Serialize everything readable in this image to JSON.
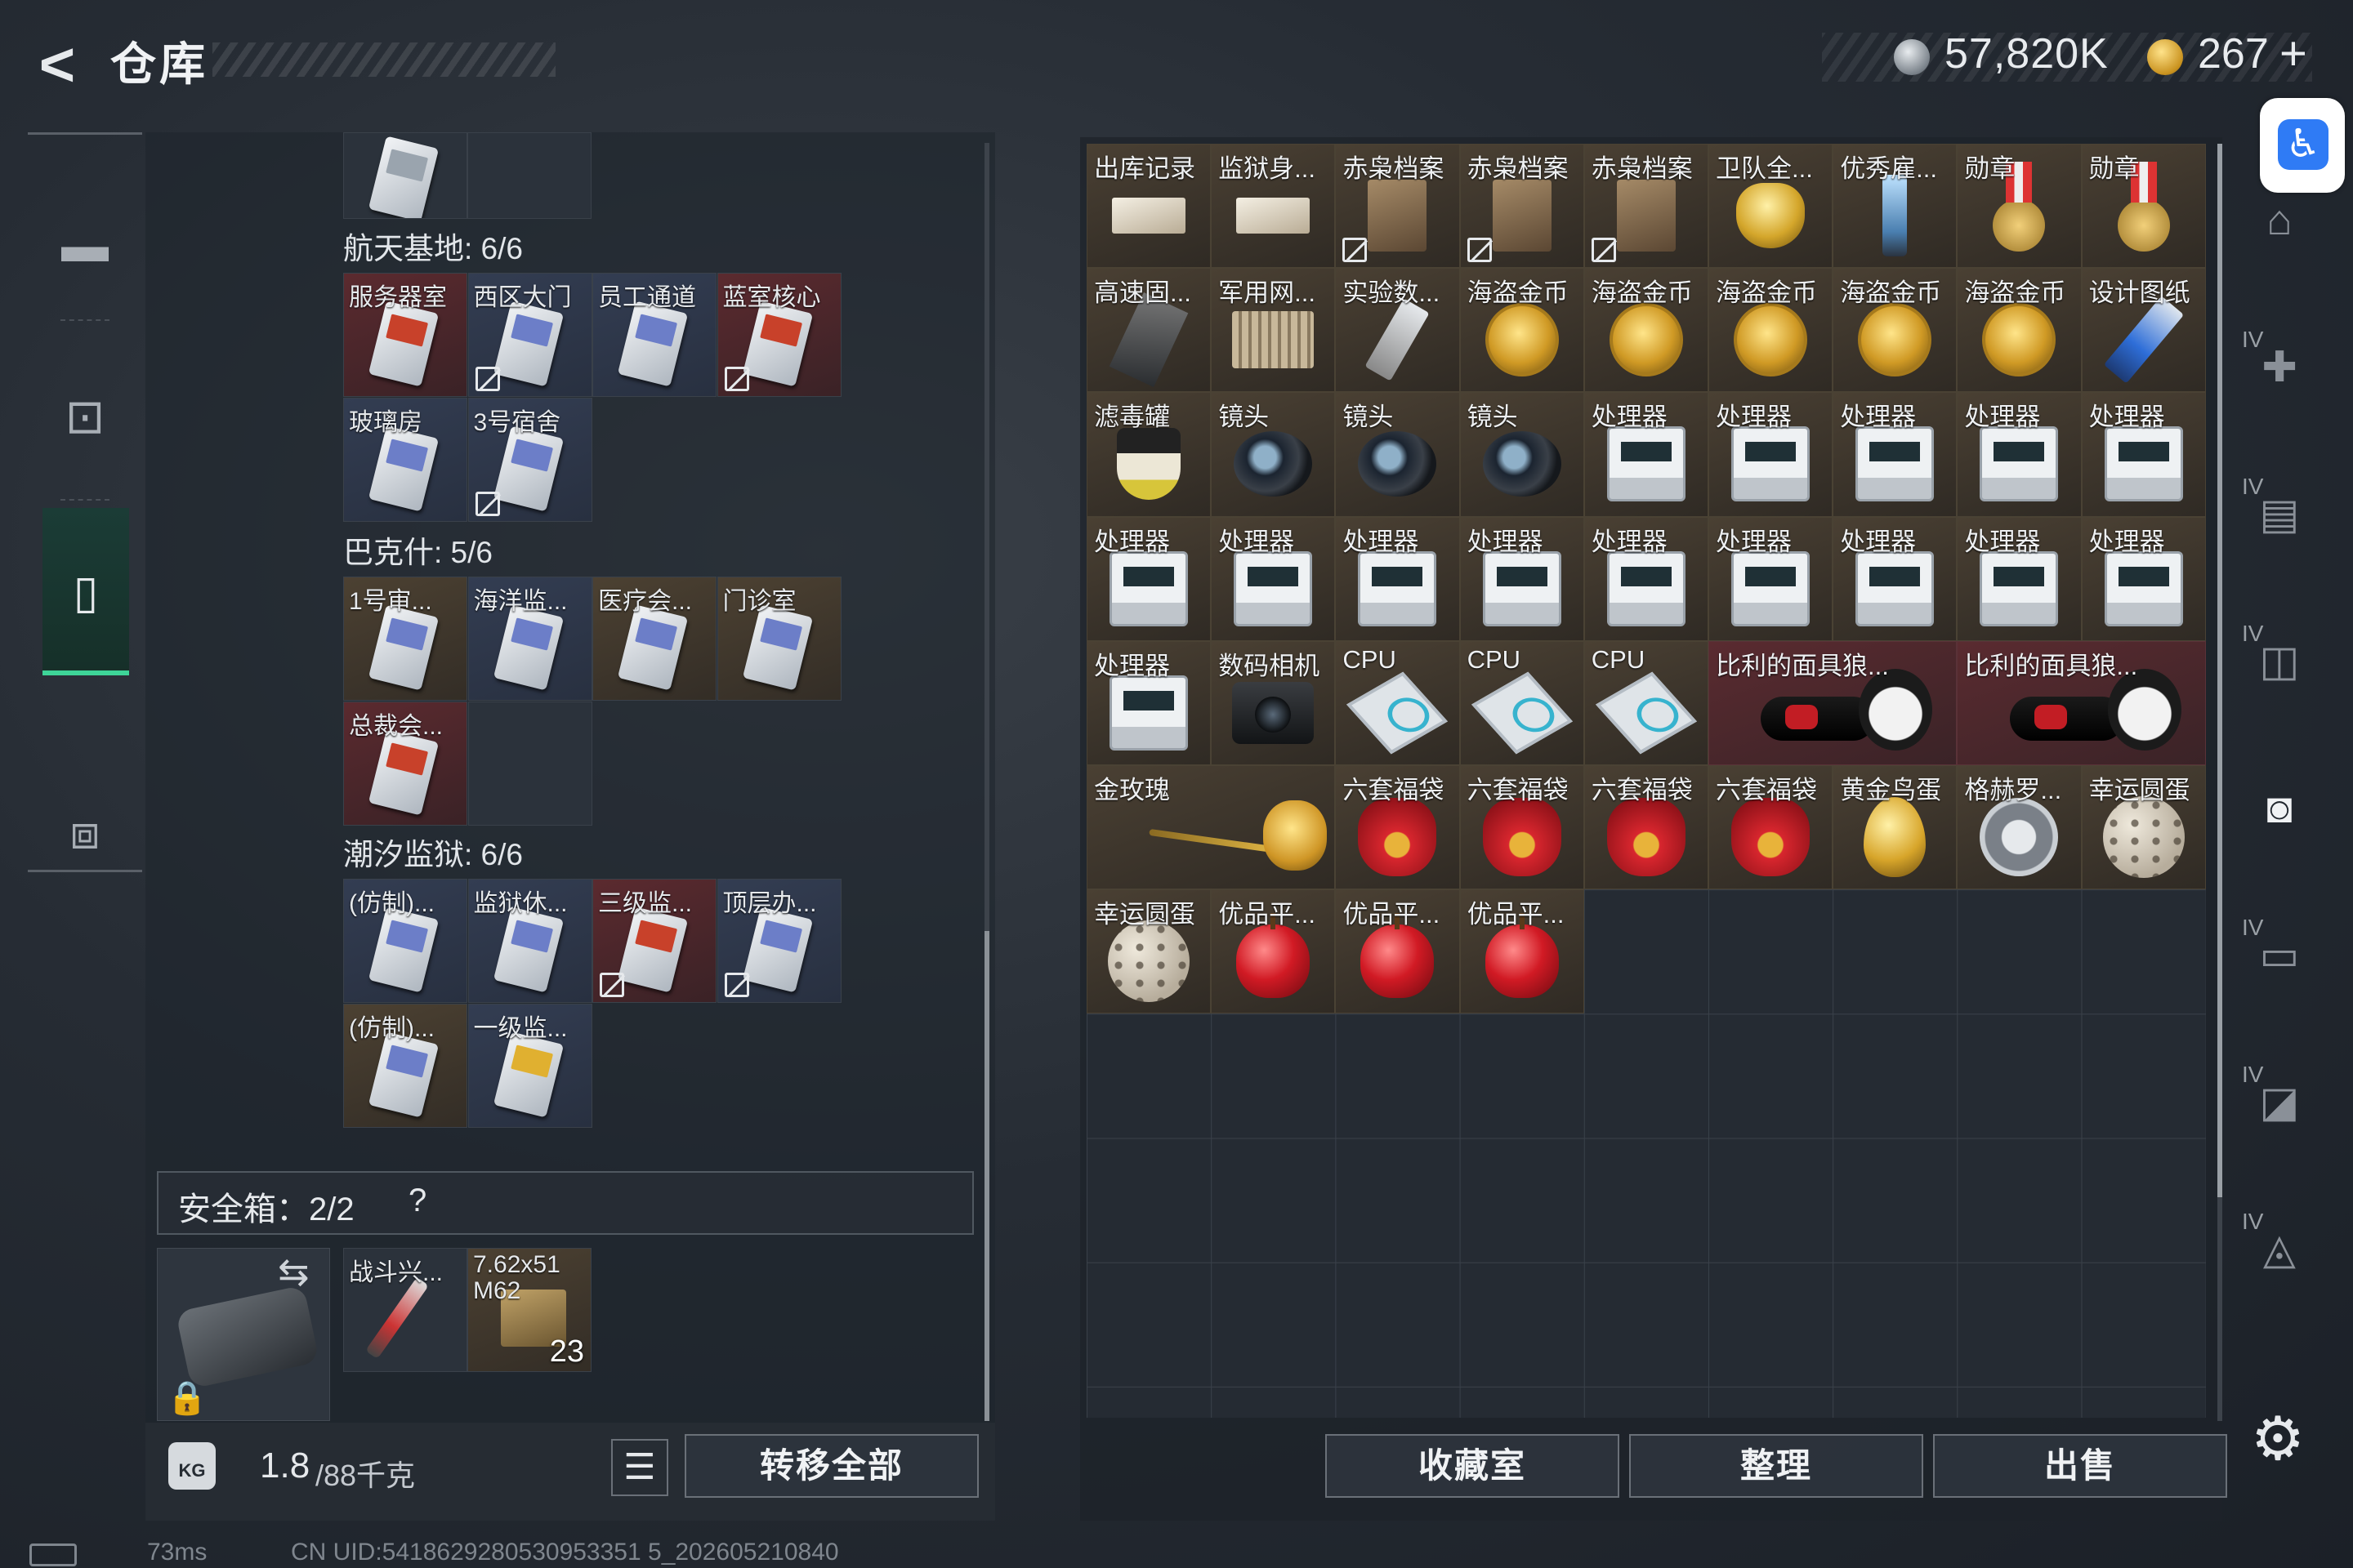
{
  "header": {
    "back_label": "<",
    "title": "仓库",
    "money": "57,820K",
    "coins": "267",
    "coins_plus": "+"
  },
  "left_nav": {
    "icons": [
      "gun-icon",
      "backpack-icon",
      "case-icon",
      "toolbox-icon"
    ],
    "active": "case-icon"
  },
  "stash": {
    "sections": [
      {
        "label": "航天基地: 6/6",
        "items": [
          {
            "label": "服务器室",
            "bg": "red",
            "no_insure": false
          },
          {
            "label": "西区大门",
            "bg": "blue",
            "no_insure": true
          },
          {
            "label": "员工通道",
            "bg": "blue",
            "no_insure": false
          },
          {
            "label": "蓝室核心",
            "bg": "red",
            "no_insure": true
          },
          {
            "label": "玻璃房",
            "bg": "blue",
            "no_insure": false
          },
          {
            "label": "3号宿舍",
            "bg": "blue",
            "no_insure": true
          }
        ]
      },
      {
        "label": "巴克什: 5/6",
        "items": [
          {
            "label": "1号审...",
            "bg": "gold",
            "no_insure": false
          },
          {
            "label": "海洋监...",
            "bg": "blue",
            "no_insure": false
          },
          {
            "label": "医疗会...",
            "bg": "gold",
            "no_insure": false
          },
          {
            "label": "门诊室",
            "bg": "gold",
            "no_insure": false
          },
          {
            "label": "总裁会...",
            "bg": "red",
            "no_insure": false
          }
        ]
      },
      {
        "label": "潮汐监狱: 6/6",
        "items": [
          {
            "label": "(仿制)...",
            "bg": "blue",
            "no_insure": false
          },
          {
            "label": "监狱休...",
            "bg": "blue",
            "no_insure": false
          },
          {
            "label": "三级监...",
            "bg": "red",
            "no_insure": true
          },
          {
            "label": "顶层办...",
            "bg": "blue",
            "no_insure": true
          },
          {
            "label": "(仿制)...",
            "bg": "gold",
            "no_insure": false
          },
          {
            "label": "一级监...",
            "bg": "blue",
            "no_insure": false
          }
        ]
      }
    ]
  },
  "safebox": {
    "label": "安全箱：2/2",
    "help": "?",
    "items": [
      {
        "label": "战斗兴...",
        "qty": ""
      },
      {
        "label": "7.62x51 M62",
        "qty": "23"
      }
    ]
  },
  "footer": {
    "weight": "1.8",
    "weight_max": "/88千克",
    "kg_label": "KG",
    "transfer_all": "转移全部",
    "collection": "收藏室",
    "sort": "整理",
    "sell": "出售"
  },
  "storage": {
    "items": [
      {
        "label": "出库记录",
        "icon": "paper"
      },
      {
        "label": "监狱身...",
        "icon": "paper"
      },
      {
        "label": "赤枭档案",
        "icon": "folder",
        "no_insure": true
      },
      {
        "label": "赤枭档案",
        "icon": "folder",
        "no_insure": true
      },
      {
        "label": "赤枭档案",
        "icon": "folder",
        "no_insure": true
      },
      {
        "label": "卫队全...",
        "icon": "ring"
      },
      {
        "label": "优秀雇...",
        "icon": "trophy"
      },
      {
        "label": "勋章",
        "icon": "medal"
      },
      {
        "label": "勋章",
        "icon": "medal"
      },
      {
        "label": "高速固...",
        "icon": "ssd"
      },
      {
        "label": "军用网...",
        "icon": "router"
      },
      {
        "label": "实验数...",
        "icon": "usb"
      },
      {
        "label": "海盗金币",
        "icon": "coin"
      },
      {
        "label": "海盗金币",
        "icon": "coin"
      },
      {
        "label": "海盗金币",
        "icon": "coin"
      },
      {
        "label": "海盗金币",
        "icon": "coin"
      },
      {
        "label": "海盗金币",
        "icon": "coin"
      },
      {
        "label": "设计图纸",
        "icon": "blue"
      },
      {
        "label": "滤毒罐",
        "icon": "filter"
      },
      {
        "label": "镜头",
        "icon": "lens"
      },
      {
        "label": "镜头",
        "icon": "lens"
      },
      {
        "label": "镜头",
        "icon": "lens"
      },
      {
        "label": "处理器",
        "icon": "cpuboard"
      },
      {
        "label": "处理器",
        "icon": "cpuboard"
      },
      {
        "label": "处理器",
        "icon": "cpuboard"
      },
      {
        "label": "处理器",
        "icon": "cpuboard"
      },
      {
        "label": "处理器",
        "icon": "cpuboard"
      },
      {
        "label": "处理器",
        "icon": "cpuboard"
      },
      {
        "label": "处理器",
        "icon": "cpuboard"
      },
      {
        "label": "处理器",
        "icon": "cpuboard"
      },
      {
        "label": "处理器",
        "icon": "cpuboard"
      },
      {
        "label": "处理器",
        "icon": "cpuboard"
      },
      {
        "label": "处理器",
        "icon": "cpuboard"
      },
      {
        "label": "处理器",
        "icon": "cpuboard"
      },
      {
        "label": "处理器",
        "icon": "cpuboard"
      },
      {
        "label": "处理器",
        "icon": "cpuboard"
      },
      {
        "label": "处理器",
        "icon": "cpuboard"
      },
      {
        "label": "数码相机",
        "icon": "camera"
      },
      {
        "label": "CPU",
        "icon": "chip"
      },
      {
        "label": "CPU",
        "icon": "chip"
      },
      {
        "label": "CPU",
        "icon": "chip"
      },
      {
        "label": "比利的面具狼...",
        "icon": "doll",
        "wide": true,
        "red": true
      },
      {
        "label": "比利的面具狼...",
        "icon": "doll",
        "wide": true,
        "red": true
      },
      {
        "label": "金玫瑰",
        "icon": "rose",
        "wide": true
      },
      {
        "label": "六套福袋",
        "icon": "bag"
      },
      {
        "label": "六套福袋",
        "icon": "bag"
      },
      {
        "label": "六套福袋",
        "icon": "bag"
      },
      {
        "label": "六套福袋",
        "icon": "bag"
      },
      {
        "label": "黄金鸟蛋",
        "icon": "egg"
      },
      {
        "label": "格赫罗...",
        "icon": "emblem"
      },
      {
        "label": "幸运圆蛋",
        "icon": "qegg"
      },
      {
        "label": "幸运圆蛋",
        "icon": "qegg"
      },
      {
        "label": "优品平...",
        "icon": "apple"
      },
      {
        "label": "优品平...",
        "icon": "apple"
      },
      {
        "label": "优品平...",
        "icon": "apple"
      }
    ]
  },
  "right_nav": {
    "icons": [
      "home-icon",
      "medkit-icon",
      "armor-icon",
      "loot-icon",
      "collection-icon",
      "folder-icon",
      "gear-ammo-icon",
      "box-icon"
    ],
    "tag": "IV"
  },
  "status": {
    "ping": "73ms",
    "uid": "CN UID:5418629280530953351 5_202605210840"
  }
}
